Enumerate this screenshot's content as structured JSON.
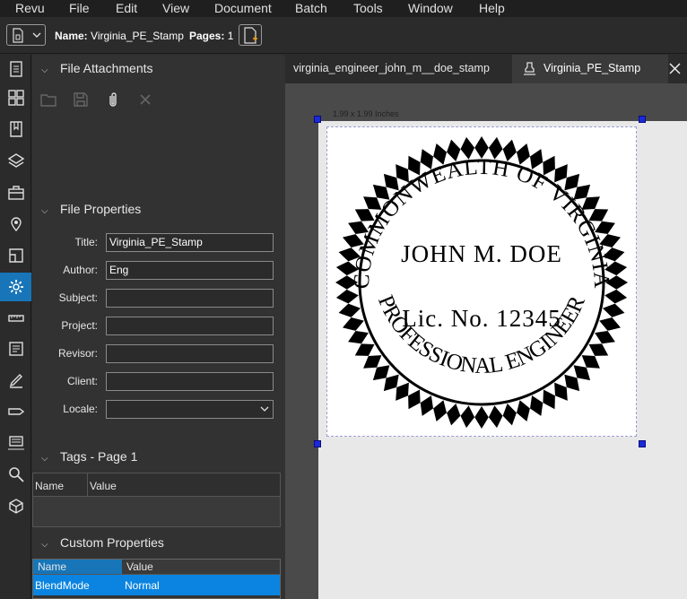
{
  "menu": [
    "Revu",
    "File",
    "Edit",
    "View",
    "Document",
    "Batch",
    "Tools",
    "Window",
    "Help"
  ],
  "toolbar": {
    "name_label": "Name:",
    "name_value": "Virginia_PE_Stamp",
    "pages_label": "Pages:",
    "pages_value": "1"
  },
  "sidebar_icons": [
    "thumbnails-icon",
    "grid-icon",
    "bookmarks-icon",
    "layers-icon",
    "toolchest-icon",
    "places-icon",
    "markups-icon",
    "properties-icon",
    "measure-icon",
    "forms-icon",
    "signature-icon",
    "tag-icon",
    "studio-icon",
    "search-icon",
    "3d-icon"
  ],
  "panel": {
    "attachments_title": "File Attachments",
    "properties_title": "File Properties",
    "fields": [
      {
        "label": "Title:",
        "value": "Virginia_PE_Stamp"
      },
      {
        "label": "Author:",
        "value": "Eng"
      },
      {
        "label": "Subject:",
        "value": ""
      },
      {
        "label": "Project:",
        "value": ""
      },
      {
        "label": "Revisor:",
        "value": ""
      },
      {
        "label": "Client:",
        "value": ""
      },
      {
        "label": "Locale:",
        "value": ""
      }
    ],
    "tags_title": "Tags - Page 1",
    "tags_cols": [
      "Name",
      "Value"
    ],
    "custom_title": "Custom Properties",
    "custom_cols": [
      "Name",
      "Value"
    ],
    "custom_rows": [
      {
        "name": "BlendMode",
        "value": "Normal"
      }
    ]
  },
  "tabs": [
    {
      "label": "virginia_engineer_john_m__doe_stamp"
    },
    {
      "label": "Virginia_PE_Stamp"
    }
  ],
  "canvas": {
    "dimension_label": "1.99 x 1.99 Inches"
  },
  "stamp": {
    "top_text": "COMMONWEALTH OF VIRGINIA",
    "bottom_text": "PROFESSIONAL ENGINEER",
    "name": "JOHN M. DOE",
    "license": "Lic. No. 12345"
  },
  "colors": {
    "accent": "#1775b8",
    "selection": "#0a84e0"
  }
}
